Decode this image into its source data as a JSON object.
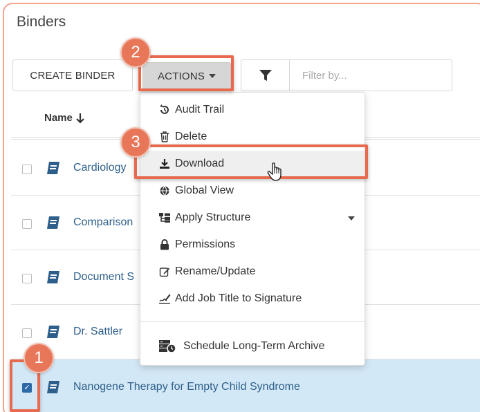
{
  "panel": {
    "title": "Binders"
  },
  "toolbar": {
    "create_label": "CREATE BINDER",
    "actions_label": "ACTIONS",
    "filter_placeholder": "Filter by..."
  },
  "table": {
    "column_name": "Name",
    "rows": [
      {
        "label": "Cardiology",
        "checked": false
      },
      {
        "label": "Comparison",
        "checked": false
      },
      {
        "label": "Document S",
        "checked": false
      },
      {
        "label": "Dr. Sattler",
        "checked": false
      },
      {
        "label": "Nanogene Therapy for Empty Child Syndrome",
        "checked": true
      }
    ]
  },
  "actions_menu": {
    "items": [
      {
        "label": "Audit Trail",
        "icon": "history-icon"
      },
      {
        "label": "Delete",
        "icon": "trash-icon"
      },
      {
        "label": "Download",
        "icon": "download-icon"
      },
      {
        "label": "Global View",
        "icon": "globe-icon"
      },
      {
        "label": "Apply Structure",
        "icon": "structure-icon"
      },
      {
        "label": "Permissions",
        "icon": "lock-icon"
      },
      {
        "label": "Rename/Update",
        "icon": "edit-icon"
      },
      {
        "label": "Add Job Title to Signature",
        "icon": "signature-icon"
      },
      {
        "label": "Schedule Long-Term Archive",
        "icon": "archive-schedule-icon"
      }
    ]
  },
  "callouts": {
    "step1": "1",
    "step2": "2",
    "step3": "3"
  },
  "colors": {
    "accent": "#e86a4e",
    "link": "#2e5f8a",
    "selected_row": "#d3e8f6",
    "checkbox": "#2f6aa8"
  }
}
